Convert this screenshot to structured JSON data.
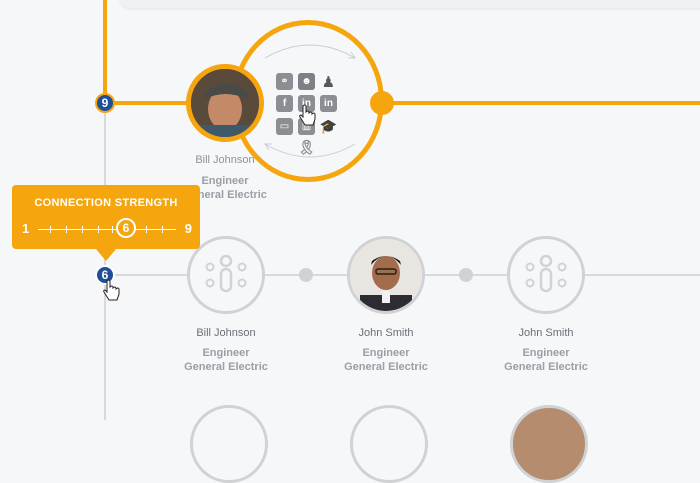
{
  "top_connection": {
    "strength": "9",
    "person": {
      "name": "Bill Johnson",
      "title": "Engineer",
      "company": "General Electric"
    },
    "social_icons": [
      "family-icon",
      "people-icon",
      "person-icon",
      "facebook-icon",
      "linkedin-icon",
      "linkedin-icon",
      "briefcase-icon",
      "building-icon",
      "graduation-cap-icon",
      "ribbon-icon"
    ]
  },
  "tooltip": {
    "title": "CONNECTION STRENGTH",
    "min": "1",
    "max": "9",
    "value": "6"
  },
  "second_connection": {
    "strength": "6",
    "people": [
      {
        "name": "Bill Johnson",
        "title": "Engineer",
        "company": "General Electric"
      },
      {
        "name": "John Smith",
        "title": "Engineer",
        "company": "General Electric"
      },
      {
        "name": "John Smith",
        "title": "Engineer",
        "company": "General Electric"
      }
    ]
  },
  "colors": {
    "accent": "#f5a50e",
    "badge": "#1f4f96",
    "connector": "#d7d9dd"
  }
}
